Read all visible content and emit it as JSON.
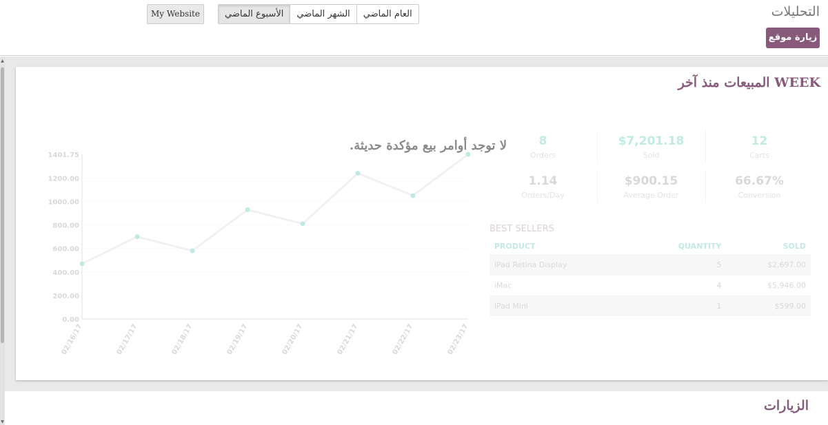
{
  "control_panel": {
    "title": "التحليلات",
    "visit_site_label": "زيارة موقع",
    "website_label": "My Website",
    "periods": [
      {
        "label": "الأسبوع الماضي",
        "active": true
      },
      {
        "label": "الشهر الماضي",
        "active": false
      },
      {
        "label": "العام الماضي",
        "active": false
      }
    ]
  },
  "sales": {
    "title": "المبيعات منذ آخر WEEK",
    "no_orders_message": "لا توجد أوامر بيع مؤكدة حديثة.",
    "kpis": [
      {
        "value": "8",
        "label": "Orders"
      },
      {
        "value": "$7,201.18",
        "label": "Sold"
      },
      {
        "value": "12",
        "label": "Carts"
      },
      {
        "value": "1.14",
        "label": "Orders/Day"
      },
      {
        "value": "$900.15",
        "label": "Average Order"
      },
      {
        "value": "66.67%",
        "label": "Conversion"
      }
    ],
    "best_sellers": {
      "title": "BEST SELLERS",
      "columns": [
        "PRODUCT",
        "QUANTITY",
        "SOLD"
      ],
      "rows": [
        [
          "iPad Retina Display",
          "5",
          "$2,697.00"
        ],
        [
          "iMac",
          "4",
          "$5,946.00"
        ],
        [
          "iPad Mini",
          "1",
          "$599.00"
        ]
      ]
    }
  },
  "chart_data": {
    "type": "line",
    "x": [
      "02/16/17",
      "02/17/17",
      "02/18/17",
      "02/19/17",
      "02/20/17",
      "02/21/17",
      "02/22/17",
      "02/23/17"
    ],
    "values": [
      470,
      700,
      580,
      930,
      810,
      1240,
      1050,
      1401.75
    ],
    "y_ticks": [
      "1401.75",
      "1200.00",
      "1000.00",
      "800.00",
      "600.00",
      "400.00",
      "200.00",
      "0.00"
    ],
    "ylim": [
      0,
      1401.75
    ],
    "grid": true,
    "line_color": "#cfcfcf",
    "point_color": "#21b799"
  },
  "visits": {
    "title": "الزيارات"
  }
}
